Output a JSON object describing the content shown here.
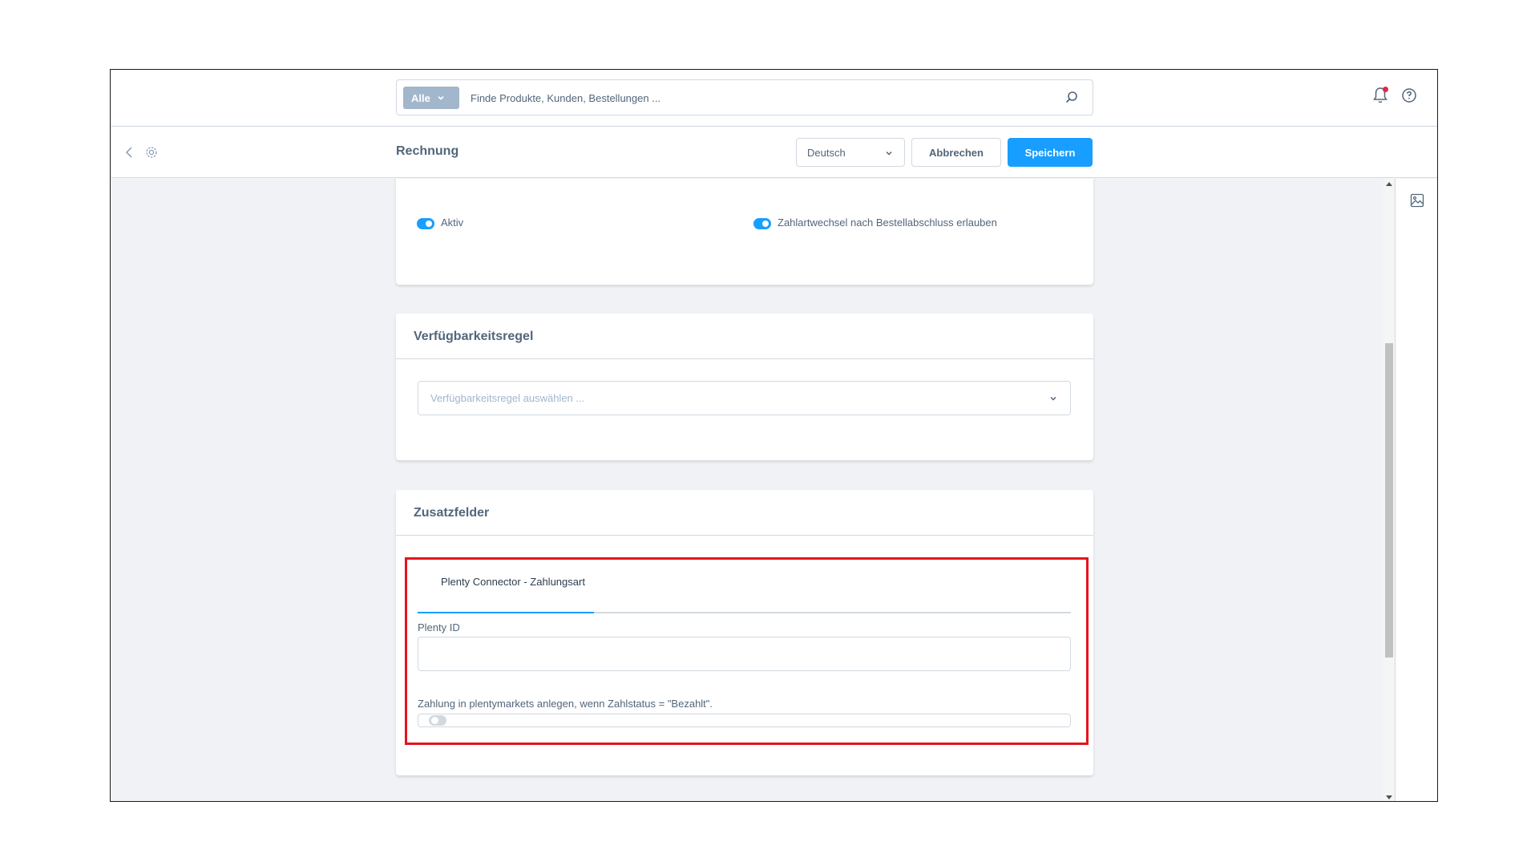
{
  "search": {
    "scope_label": "Alle",
    "placeholder": "Finde Produkte, Kunden, Bestellungen ..."
  },
  "header": {
    "title": "Rechnung",
    "language": "Deutsch",
    "cancel_label": "Abbrechen",
    "save_label": "Speichern"
  },
  "general_card": {
    "active_label": "Aktiv",
    "active_on": true,
    "allow_change_label": "Zahlartwechsel nach Bestellabschluss erlauben",
    "allow_change_on": true
  },
  "availability_card": {
    "title": "Verfügbarkeitsregel",
    "select_placeholder": "Verfügbarkeitsregel auswählen ..."
  },
  "extra_fields_card": {
    "title": "Zusatzfelder",
    "tab_label": "Plenty Connector - Zahlungsart",
    "plenty_id_label": "Plenty ID",
    "plenty_id_value": "",
    "payment_toggle_label": "Zahlung in plentymarkets anlegen, wenn Zahlstatus = \"Bezahlt\".",
    "payment_toggle_on": false
  },
  "colors": {
    "primary": "#189eff",
    "highlight_border": "#e3141e",
    "notification_dot": "#de294c"
  },
  "icons": [
    "search-icon",
    "bell-icon",
    "help-icon",
    "back-icon",
    "gear-icon",
    "chevron-down-icon",
    "media-icon"
  ]
}
